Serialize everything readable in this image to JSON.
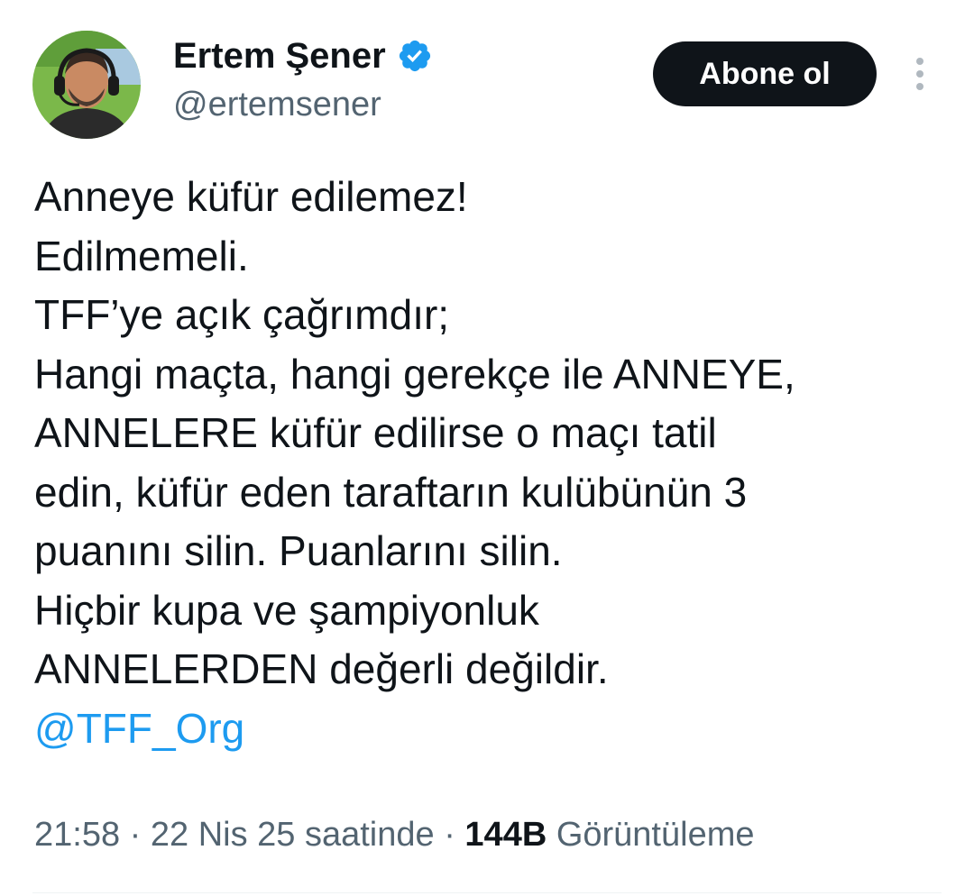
{
  "author": {
    "display_name": "Ertem Şener",
    "handle": "@ertemsener",
    "verified": true
  },
  "actions": {
    "subscribe_label": "Abone ol",
    "more_icon": "more-vertical-icon"
  },
  "tweet": {
    "lines": [
      "Anneye küfür edilemez!",
      "Edilmemeli.",
      "TFF’ye açık çağrımdır;",
      "Hangi maçta, hangi gerekçe ile ANNEYE,",
      "ANNELERE küfür edilirse o maçı tatil",
      "edin, küfür eden taraftarın kulübünün 3",
      "puanını silin. Puanlarını silin.",
      "Hiçbir kupa ve şampiyonluk",
      "ANNELERDEN değerli değildir."
    ],
    "mention": "@TFF_Org"
  },
  "meta": {
    "time": "21:58",
    "sep1": " · ",
    "date": "22 Nis 25 saatinde",
    "sep2": " · ",
    "views_count": "144B",
    "views_label": " Görüntüleme"
  },
  "colors": {
    "text": "#0f1419",
    "secondary": "#536471",
    "link": "#1d9bf0",
    "verified": "#1d9bf0",
    "button_bg": "#0f1419"
  }
}
